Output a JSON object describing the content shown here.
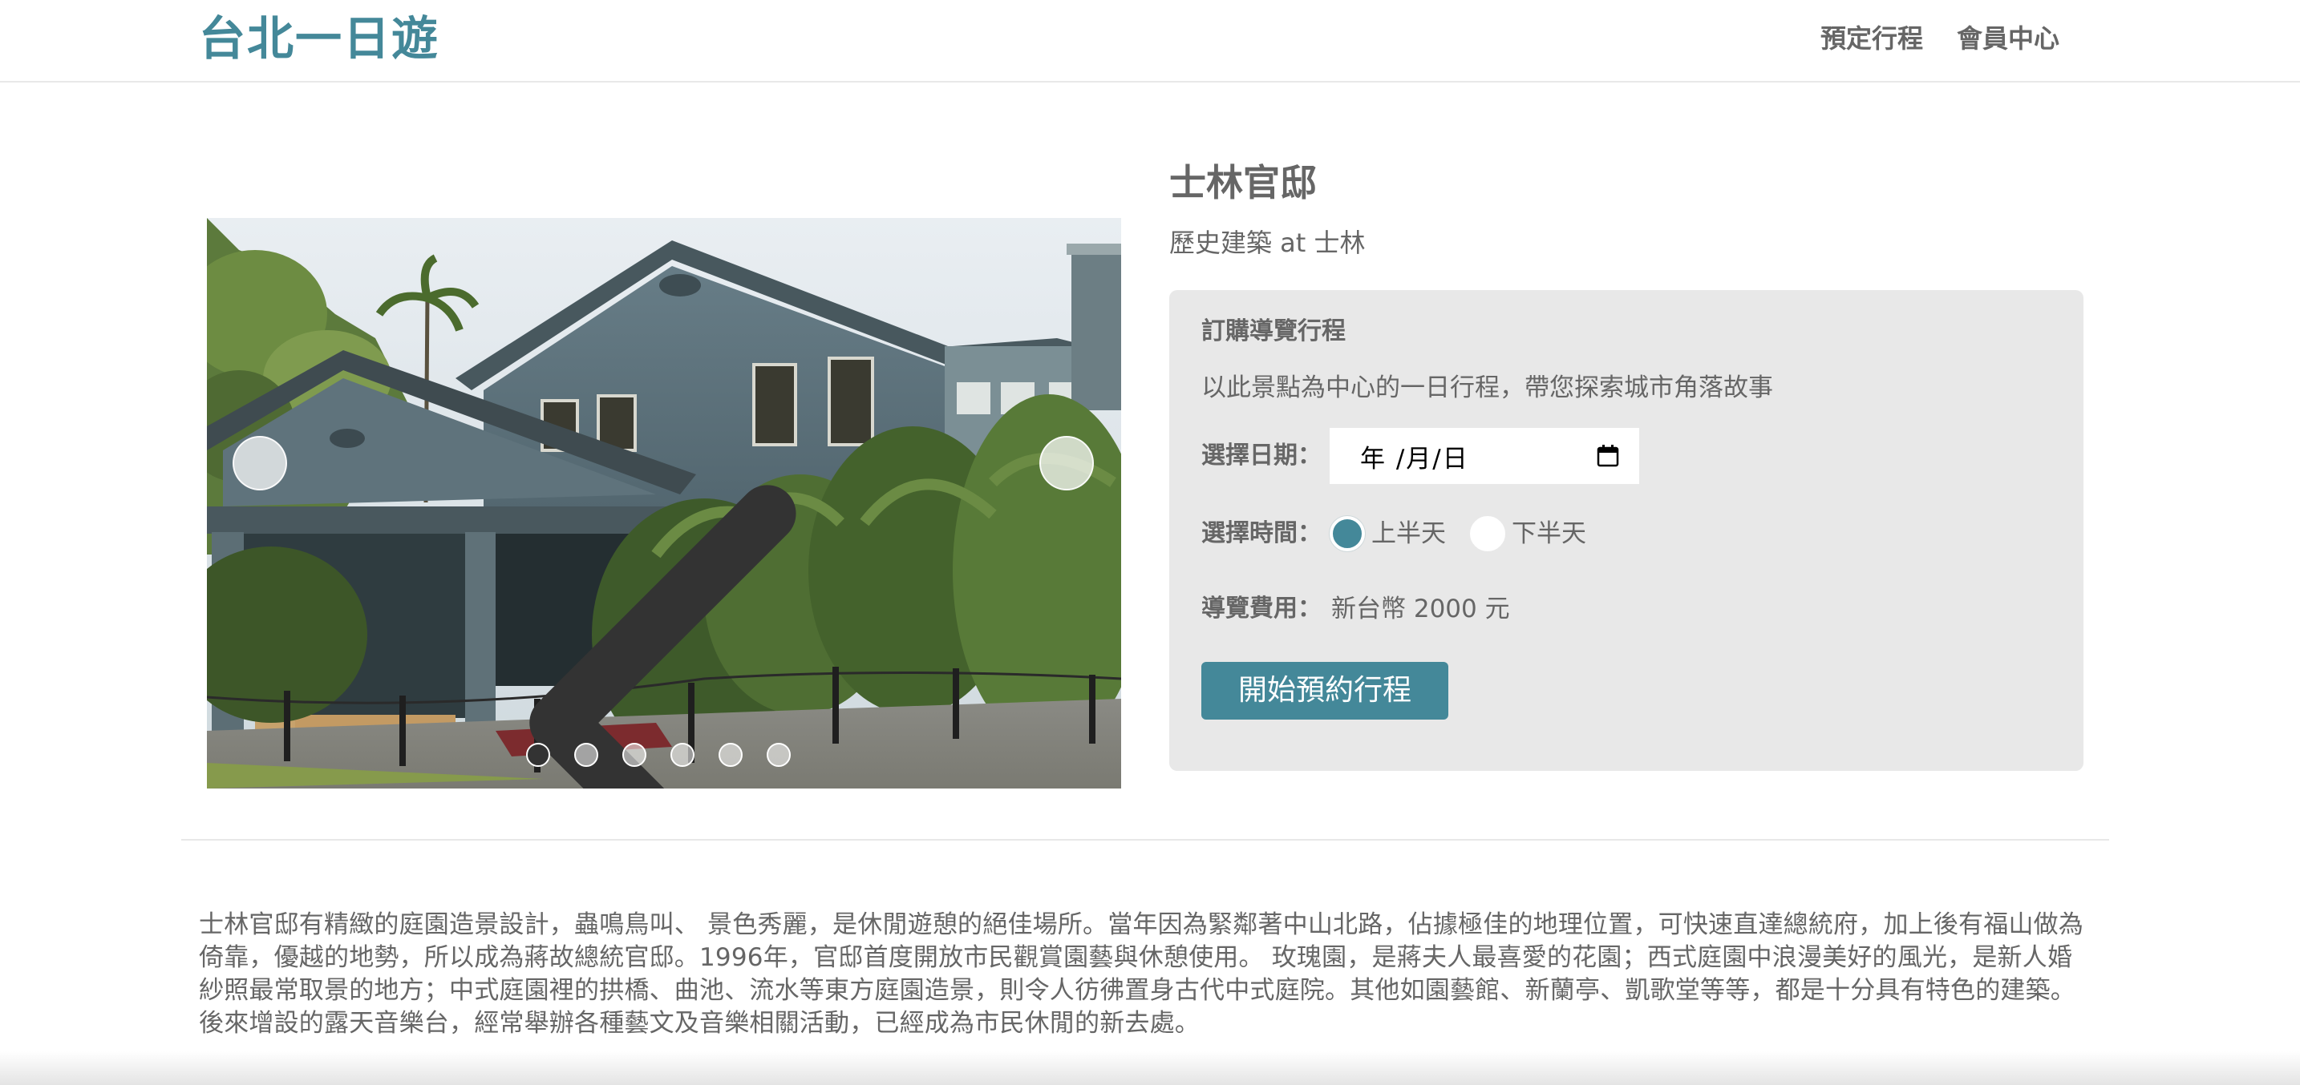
{
  "header": {
    "brand": "台北一日遊",
    "nav": [
      "預定行程",
      "會員中心"
    ]
  },
  "carousel": {
    "slide_count": 6,
    "active_index": 0,
    "prev_icon": "chevron-left-icon",
    "next_icon": "chevron-right-icon"
  },
  "attraction": {
    "name": "士林官邸",
    "category_line": "歷史建築 at 士林"
  },
  "booking": {
    "title": "訂購導覽行程",
    "description": "以此景點為中心的一日行程，帶您探索城市角落故事",
    "date_label": "選擇日期：",
    "date_value": "年 /月/日",
    "time_label": "選擇時間：",
    "time_options": [
      "上半天",
      "下半天"
    ],
    "selected_time": "上半天",
    "fee_label": "導覽費用：",
    "fee_value": "新台幣 2000 元",
    "submit_label": "開始預約行程"
  },
  "description": "士林官邸有精緻的庭園造景設計，蟲鳴鳥叫、 景色秀麗，是休閒遊憩的絕佳場所。當年因為緊鄰著中山北路，佔據極佳的地理位置，可快速直達總統府，加上後有福山做為倚靠，優越的地勢，所以成為蔣故總統官邸。1996年，官邸首度開放市民觀賞園藝與休憩使用。 玫瑰園，是蔣夫人最喜愛的花園；西式庭園中浪漫美好的風光，是新人婚紗照最常取景的地方；中式庭園裡的拱橋、曲池、流水等東方庭園造景，則令人彷彿置身古代中式庭院。其他如園藝館、新蘭亭、凱歌堂等等，都是十分具有特色的建築。後來增設的露天音樂台，經常舉辦各種藝文及音樂相關活動，已經成為市民休閒的新去處。",
  "colors": {
    "brand": "#448899",
    "text": "#666666",
    "panel": "#e8e8e8"
  }
}
